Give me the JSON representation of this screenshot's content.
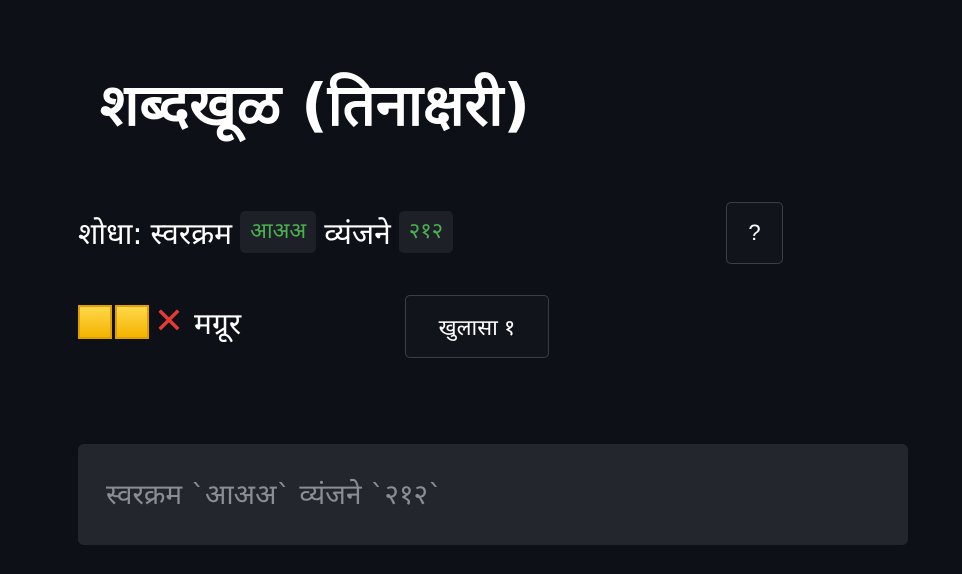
{
  "title": "शब्दखूळ (तिनाक्षरी)",
  "hint": {
    "label": "शोधा:",
    "vowel_label": "स्वरक्रम",
    "vowel_code": "आअअ",
    "consonant_label": "व्यंजने",
    "consonant_code": "२१२"
  },
  "help_button": "?",
  "guesses": [
    {
      "tiles": [
        "yellow",
        "yellow",
        "wrong"
      ],
      "word": "मग्रूर"
    }
  ],
  "reveal_button": "खुलासा १",
  "answer_input": {
    "placeholder": "स्वरक्रम `आअअ` व्यंजने `२१२`",
    "value": ""
  },
  "colors": {
    "background": "#0d1016",
    "code_green": "#4caf50",
    "tile_yellow": "#f4b400",
    "wrong_red": "#e53935",
    "input_bg": "#24262e"
  }
}
